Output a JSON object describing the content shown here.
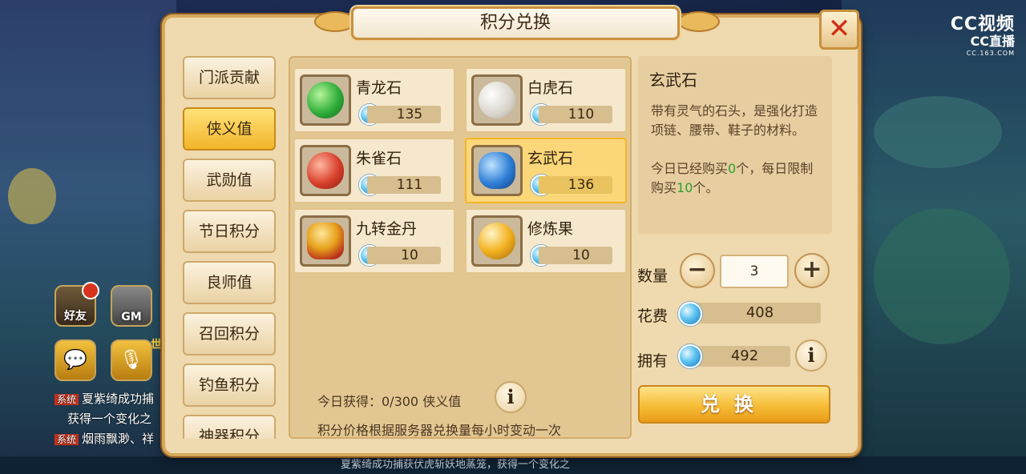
{
  "brand": {
    "logo_text": "CC视频",
    "logo_sub": "CC直播",
    "logo_url_text": "CC.163.COM"
  },
  "hud": {
    "friends_label": "好友",
    "gm_label": "GM",
    "world_label": "世",
    "chat": [
      {
        "tag": "系统",
        "text": "夏紫绮成功捕"
      },
      {
        "tag": "",
        "text": "获得一个变化之"
      },
      {
        "tag": "系统",
        "text": "烟雨飘渺、祥"
      }
    ],
    "bottom_ticker": "夏紫绮成功捕获伏虎斩妖地蒸笼，获得一个变化之"
  },
  "dialog": {
    "title": "积分兑换",
    "close_icon": "close-icon"
  },
  "tabs": [
    {
      "label": "门派贡献",
      "active": false
    },
    {
      "label": "侠义值",
      "active": true
    },
    {
      "label": "武勋值",
      "active": false
    },
    {
      "label": "节日积分",
      "active": false
    },
    {
      "label": "良师值",
      "active": false
    },
    {
      "label": "召回积分",
      "active": false
    },
    {
      "label": "钓鱼积分",
      "active": false
    },
    {
      "label": "神器积分",
      "active": false
    }
  ],
  "items": [
    {
      "name": "青龙石",
      "price": "135",
      "icon": "green-dragon-stone-icon",
      "color": "#2fae3a",
      "selected": false
    },
    {
      "name": "白虎石",
      "price": "110",
      "icon": "white-tiger-stone-icon",
      "color": "#e8e4dc",
      "selected": false
    },
    {
      "name": "朱雀石",
      "price": "111",
      "icon": "vermilion-bird-stone-icon",
      "color": "#d8402c",
      "selected": false
    },
    {
      "name": "玄武石",
      "price": "136",
      "icon": "black-tortoise-stone-icon",
      "color": "#2f7fd6",
      "selected": true
    },
    {
      "name": "九转金丹",
      "price": "10",
      "icon": "golden-elixir-icon",
      "color": "#e7a11c",
      "selected": false
    },
    {
      "name": "修炼果",
      "price": "10",
      "icon": "cultivation-fruit-icon",
      "color": "#f3b322",
      "selected": false
    }
  ],
  "footer": {
    "today_earned": "今日获得：0/300 侠义值",
    "note": "积分价格根据服务器兑换量每小时变动一次"
  },
  "detail": {
    "title": "玄武石",
    "desc": "带有灵气的石头，是强化打造项链、腰带、鞋子的材料。",
    "limit_pre": "今日已经购买",
    "limit_bought": "0",
    "limit_mid": "个，每日限制购买",
    "limit_max": "10",
    "limit_post": "个。"
  },
  "purchase": {
    "quantity_label": "数量",
    "quantity": "3",
    "minus_icon": "minus-icon",
    "plus_icon": "plus-icon",
    "cost_label": "花费",
    "cost": "408",
    "owned_label": "拥有",
    "owned": "492",
    "exchange_label": "兑换"
  }
}
